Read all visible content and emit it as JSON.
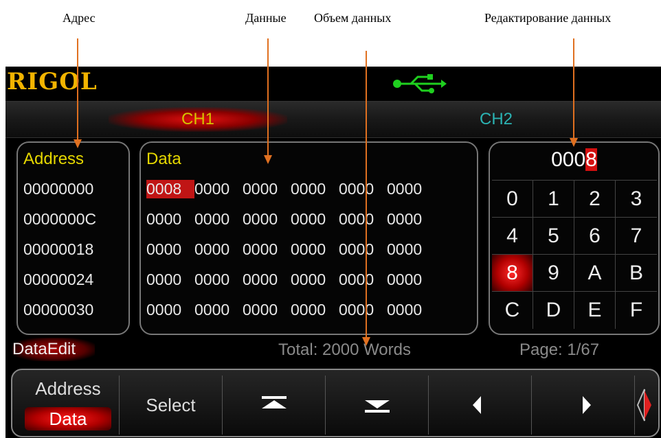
{
  "callouts": {
    "address": "Адрес",
    "data": "Данные",
    "volume": "Объем данных",
    "edit": "Редактирование данных"
  },
  "header": {
    "logo": "RIGOL",
    "usb_icon": "usb-icon"
  },
  "tabs": {
    "ch1": "CH1",
    "ch2": "CH2"
  },
  "address_panel": {
    "title": "Address",
    "rows": [
      "00000000",
      "0000000C",
      "00000018",
      "00000024",
      "00000030"
    ]
  },
  "data_panel": {
    "title": "Data",
    "rows": [
      [
        "0008",
        "0000",
        "0000",
        "0000",
        "0000",
        "0000"
      ],
      [
        "0000",
        "0000",
        "0000",
        "0000",
        "0000",
        "0000"
      ],
      [
        "0000",
        "0000",
        "0000",
        "0000",
        "0000",
        "0000"
      ],
      [
        "0000",
        "0000",
        "0000",
        "0000",
        "0000",
        "0000"
      ],
      [
        "0000",
        "0000",
        "0000",
        "0000",
        "0000",
        "0000"
      ]
    ]
  },
  "keypad": {
    "value_prefix": "000",
    "value_cursor": "8",
    "keys": [
      "0",
      "1",
      "2",
      "3",
      "4",
      "5",
      "6",
      "7",
      "8",
      "9",
      "A",
      "B",
      "C",
      "D",
      "E",
      "F"
    ],
    "selected": "8"
  },
  "status": {
    "mode": "DataEdit",
    "total": "Total: 2000 Words",
    "page": "Page: 1/67"
  },
  "softkeys": {
    "address_label": "Address",
    "data_label": "Data",
    "select_label": "Select",
    "icons": [
      "page-up-icon",
      "page-down-icon",
      "left-arrow-icon",
      "right-arrow-icon",
      "more-icon"
    ]
  },
  "colors": {
    "accent_red": "#c01515",
    "title_yellow": "#e6d800",
    "ch2_teal": "#2bb3b3",
    "logo_gold": "#f2b400",
    "callout_arrow": "#e07020"
  }
}
